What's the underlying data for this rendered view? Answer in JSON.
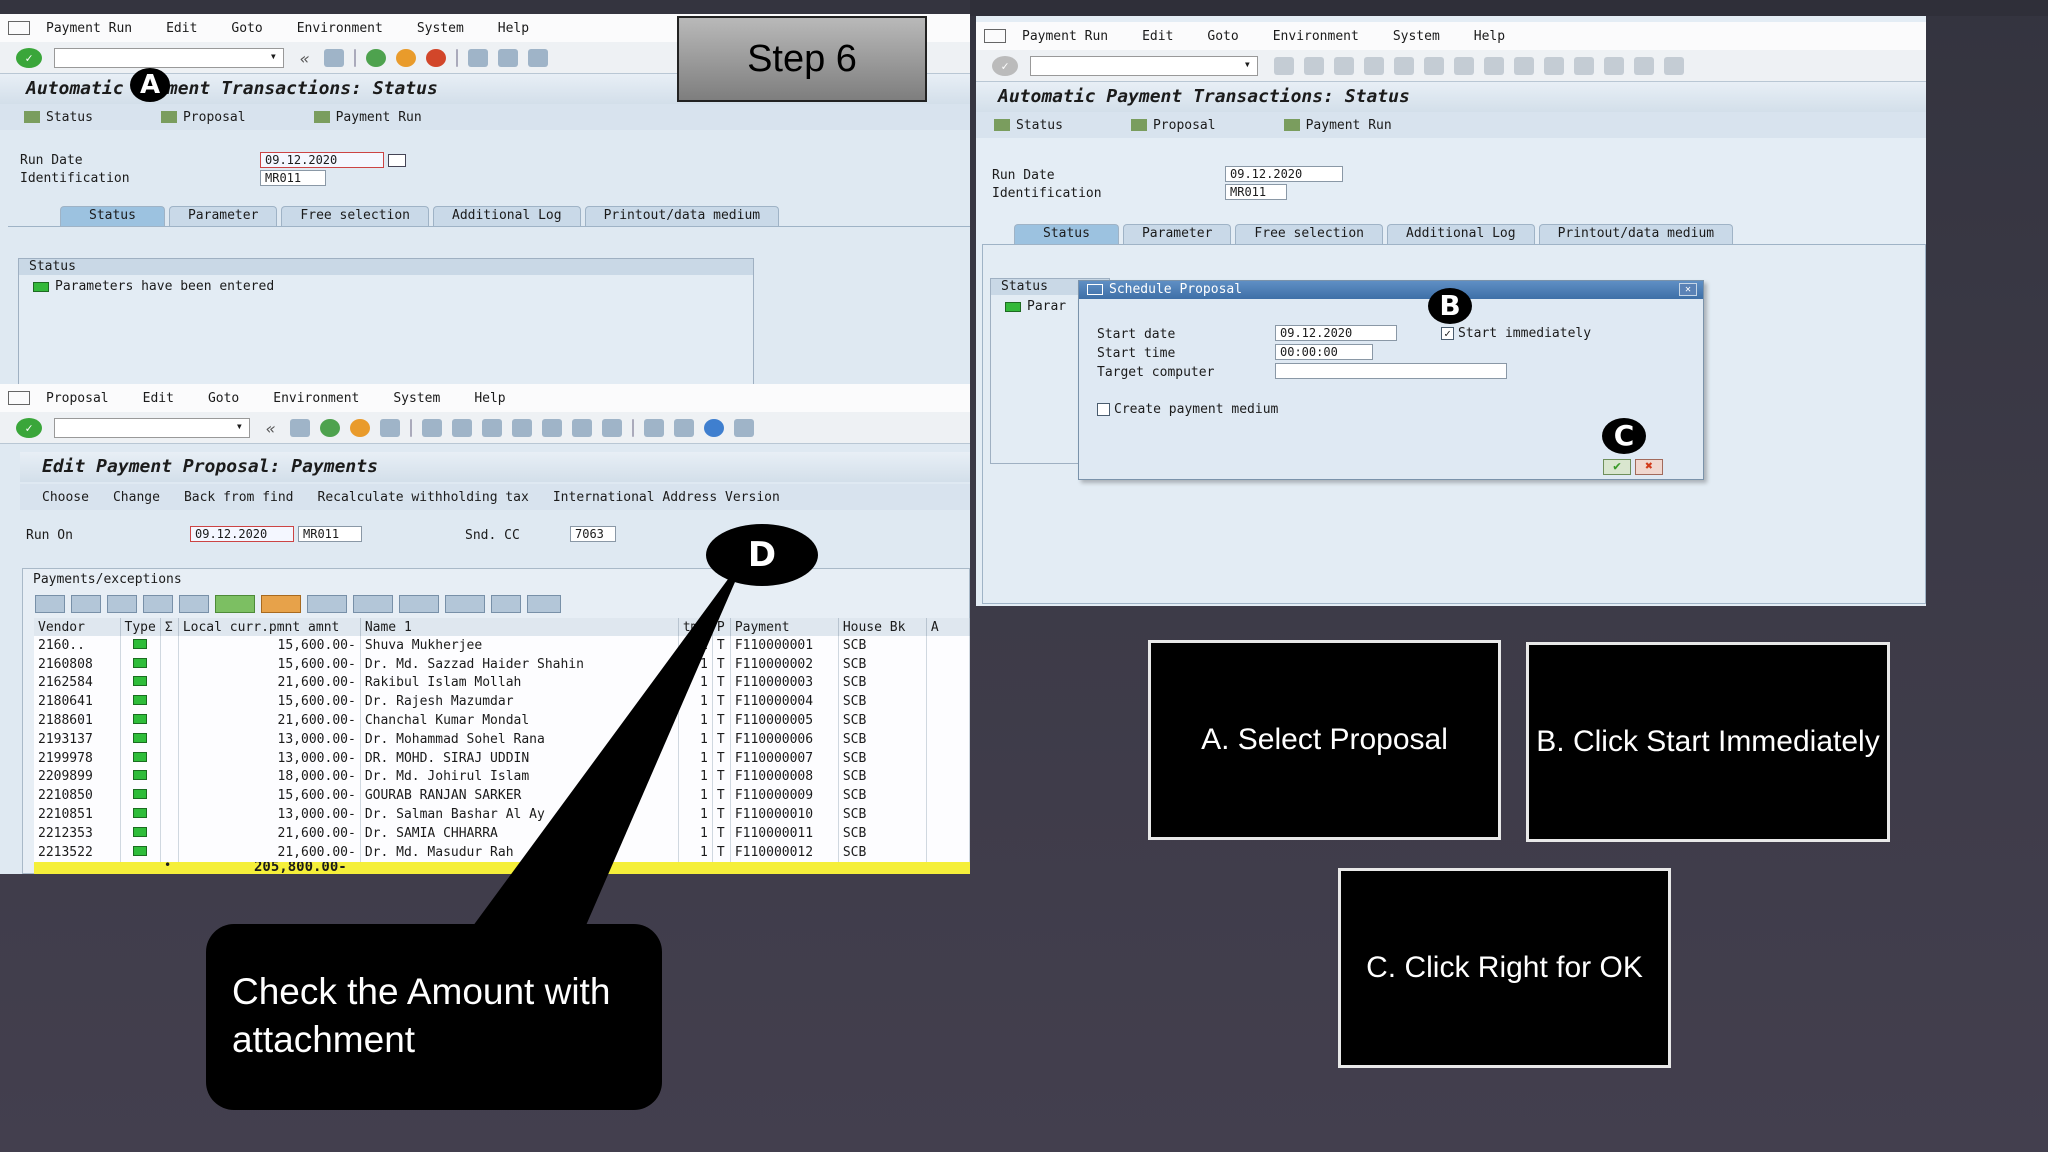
{
  "step_label": "Step 6",
  "panel_a": {
    "menu": [
      "Payment Run",
      "Edit",
      "Goto",
      "Environment",
      "System",
      "Help"
    ],
    "title": "Automatic Payment Transactions: Status",
    "app_buttons": [
      "Status",
      "Proposal",
      "Payment Run"
    ],
    "run_date_label": "Run Date",
    "run_date": "09.12.2020",
    "identification_label": "Identification",
    "identification": "MR011",
    "tabs": [
      "Status",
      "Parameter",
      "Free selection",
      "Additional Log",
      "Printout/data medium"
    ],
    "status_box_title": "Status",
    "status_msg": "Parameters have been entered"
  },
  "panel_b": {
    "menu": [
      "Payment Run",
      "Edit",
      "Goto",
      "Environment",
      "System",
      "Help"
    ],
    "title": "Automatic Payment Transactions: Status",
    "app_buttons": [
      "Status",
      "Proposal",
      "Payment Run"
    ],
    "run_date_label": "Run Date",
    "run_date": "09.12.2020",
    "identification_label": "Identification",
    "identification": "MR011",
    "tabs": [
      "Status",
      "Parameter",
      "Free selection",
      "Additional Log",
      "Printout/data medium"
    ],
    "status_box_title": "Status",
    "status_msg_partial": "Parar",
    "dialog": {
      "title": "Schedule Proposal",
      "start_date_label": "Start date",
      "start_date": "09.12.2020",
      "start_time_label": "Start time",
      "start_time": "00:00:00",
      "target_label": "Target computer",
      "target_value": "",
      "start_immediately_label": "Start immediately",
      "start_immediately_checked": "✓",
      "create_medium_label": "Create payment medium",
      "ok_glyph": "✔",
      "cancel_glyph": "✖",
      "close_glyph": "✕"
    }
  },
  "panel_c": {
    "menu": [
      "Proposal",
      "Edit",
      "Goto",
      "Environment",
      "System",
      "Help"
    ],
    "title": "Edit Payment Proposal: Payments",
    "app_buttons": [
      "Choose",
      "Change",
      "Back from find",
      "Recalculate withholding tax",
      "International Address Version"
    ],
    "run_on_label": "Run On",
    "run_on_date": "09.12.2020",
    "run_on_id": "MR011",
    "sndcc_label": "Snd. CC",
    "sndcc_value": "7063",
    "section_title": "Payments/exceptions",
    "columns": [
      "Vendor",
      "Type",
      "Σ",
      "Local curr.pmnt amnt",
      "Name 1",
      "tms",
      "P",
      "Payment",
      "House Bk",
      "A"
    ],
    "rows": [
      {
        "vendor": "2160..",
        "amount": "15,600.00-",
        "name": "Shuva Mukherjee",
        "tms": "1",
        "p": "T",
        "payment": "F110000001",
        "bank": "SCB"
      },
      {
        "vendor": "2160808",
        "amount": "15,600.00-",
        "name": "Dr. Md. Sazzad Haider Shahin",
        "tms": "1",
        "p": "T",
        "payment": "F110000002",
        "bank": "SCB"
      },
      {
        "vendor": "2162584",
        "amount": "21,600.00-",
        "name": "Rakibul Islam Mollah",
        "tms": "1",
        "p": "T",
        "payment": "F110000003",
        "bank": "SCB"
      },
      {
        "vendor": "2180641",
        "amount": "15,600.00-",
        "name": "Dr. Rajesh Mazumdar",
        "tms": "1",
        "p": "T",
        "payment": "F110000004",
        "bank": "SCB"
      },
      {
        "vendor": "2188601",
        "amount": "21,600.00-",
        "name": "Chanchal Kumar Mondal",
        "tms": "1",
        "p": "T",
        "payment": "F110000005",
        "bank": "SCB"
      },
      {
        "vendor": "2193137",
        "amount": "13,000.00-",
        "name": "Dr. Mohammad Sohel Rana",
        "tms": "1",
        "p": "T",
        "payment": "F110000006",
        "bank": "SCB"
      },
      {
        "vendor": "2199978",
        "amount": "13,000.00-",
        "name": "DR. MOHD. SIRAJ UDDIN",
        "tms": "1",
        "p": "T",
        "payment": "F110000007",
        "bank": "SCB"
      },
      {
        "vendor": "2209899",
        "amount": "18,000.00-",
        "name": "Dr. Md. Johirul  Islam",
        "tms": "1",
        "p": "T",
        "payment": "F110000008",
        "bank": "SCB"
      },
      {
        "vendor": "2210850",
        "amount": "15,600.00-",
        "name": "GOURAB RANJAN SARKER",
        "tms": "1",
        "p": "T",
        "payment": "F110000009",
        "bank": "SCB"
      },
      {
        "vendor": "2210851",
        "amount": "13,000.00-",
        "name": "Dr. Salman Bashar Al Ay",
        "tms": "1",
        "p": "T",
        "payment": "F110000010",
        "bank": "SCB"
      },
      {
        "vendor": "2212353",
        "amount": "21,600.00-",
        "name": "Dr. SAMIA CHHARRA",
        "tms": "1",
        "p": "T",
        "payment": "F110000011",
        "bank": "SCB"
      },
      {
        "vendor": "2213522",
        "amount": "21,600.00-",
        "name": "Dr. Md. Masudur Rah",
        "tms": "1",
        "p": "T",
        "payment": "F110000012",
        "bank": "SCB"
      }
    ],
    "total": "205,800.00-",
    "total_marker": "•"
  },
  "badges": {
    "a": "A",
    "b": "B",
    "c": "C",
    "d": "D"
  },
  "callout": "Check the Amount with attachment",
  "cards": {
    "a": "A. Select Proposal",
    "b": "B. Click Start Immediately",
    "c": "C. Click Right for OK"
  },
  "colors": {
    "background": "#3b3945",
    "sap_panel": "#dfe9f2",
    "callout": "#000000",
    "total_row": "#f5ef3a"
  }
}
